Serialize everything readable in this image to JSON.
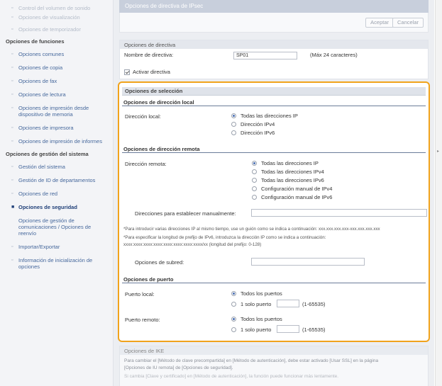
{
  "sidebar": {
    "top_items": [
      "Control del volumen de sonido",
      "Opciones de visualización",
      "Opciones de temporizador"
    ],
    "group_functions": "Opciones de funciones",
    "function_items": [
      "Opciones comunes",
      "Opciones de copia",
      "Opciones de fax",
      "Opciones de lectura",
      "Opciones de impresión desde dispositivo de memoria",
      "Opciones de impresora",
      "Opciones de impresión de informes"
    ],
    "group_system": "Opciones de gestión del sistema",
    "system_items": [
      "Gestión del sistema",
      "Gestión de ID de departamentos",
      "Opciones de red",
      "Opciones de seguridad",
      "Opciones de gestión de comunicaciones / Opciones de reenvío",
      "Importar/Exportar",
      "Información de inicialización de opciones"
    ]
  },
  "header": {
    "title": "Opciones de directiva de IPsec",
    "accept": "Aceptar",
    "cancel": "Cancelar"
  },
  "policy": {
    "section": "Opciones de directiva",
    "name_label": "Nombre de directiva:",
    "name_value": "SP01",
    "name_hint": "(Máx 24 caracteres)",
    "enable_label": "Activar directiva"
  },
  "selection": {
    "title": "Opciones de selección",
    "local": {
      "heading": "Opciones de dirección local",
      "label": "Dirección local:",
      "options": [
        "Todas las direcciones IP",
        "Dirección IPv4",
        "Dirección IPv6"
      ],
      "selected": 0
    },
    "remote": {
      "heading": "Opciones de dirección remota",
      "label": "Dirección remota:",
      "options": [
        "Todas las direcciones IP",
        "Todas las direcciones IPv4",
        "Todas las direcciones IPv6",
        "Configuración manual de IPv4",
        "Configuración manual de IPv6"
      ],
      "selected": 0,
      "manual_label": "Direcciones para establecer manualmente:",
      "manual_value": "",
      "note1": "*Para introducir varias direcciones IP al mismo tiempo, use un guión como se indica a continuación: xxx.xxx.xxx.xxx-xxx.xxx.xxx.xxx",
      "note2": "*Para especificar la longitud de prefijo de IPv6, introduzca la dirección IP como se indica a continuación:",
      "note3": "xxxx:xxxx:xxxx:xxxx:xxxx:xxxx:xxxx:xxxx/xx (longitud del prefijo: 0-128)",
      "subnet_label": "Opciones de subred:",
      "subnet_value": ""
    },
    "port": {
      "heading": "Opciones de puerto",
      "local_label": "Puerto local:",
      "remote_label": "Puerto remoto:",
      "opt_all": "Todos los puertos",
      "opt_single": "1 solo puerto",
      "range": "(1-65535)",
      "local_value": "",
      "remote_value": ""
    }
  },
  "ike": {
    "section": "Opciones de IKE",
    "text1": "Para cambiar el [Método de clave precompartida] en [Método de autenticación], debe estar activado [Usar SSL] en la página",
    "text2": "[Opciones de IU remota] de [Opciones de seguridad].",
    "text3": "Si cambia [Clave y certificado] en [Método de autenticación], la función puede funcionar más lentamente."
  }
}
